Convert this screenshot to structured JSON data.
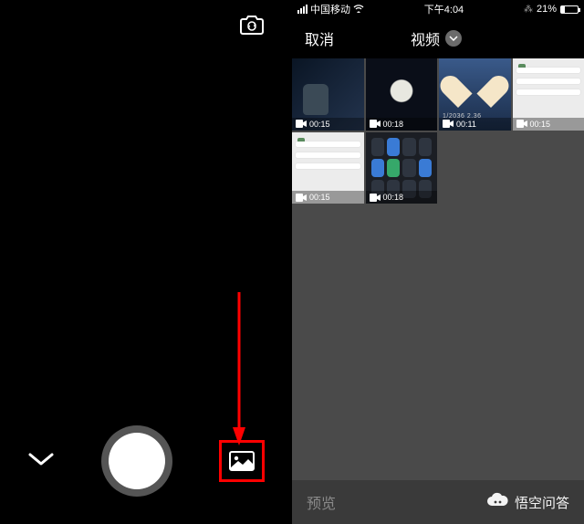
{
  "left": {
    "icons": {
      "camera_switch": "camera-switch-icon",
      "chevron": "chevron-down-icon",
      "shutter": "shutter-button",
      "gallery": "gallery-icon"
    }
  },
  "right": {
    "status": {
      "carrier": "中国移动",
      "time": "下午4:04",
      "battery_pct": "21%"
    },
    "header": {
      "cancel": "取消",
      "title": "视频"
    },
    "thumbs": [
      {
        "duration": "00:15"
      },
      {
        "duration": "00:18"
      },
      {
        "duration": "00:11",
        "subtext": "1/2036 2.36"
      },
      {
        "duration": "00:15"
      },
      {
        "duration": "00:15"
      },
      {
        "duration": "00:18"
      }
    ],
    "footer": {
      "preview": "预览"
    },
    "watermark": "悟空问答"
  }
}
